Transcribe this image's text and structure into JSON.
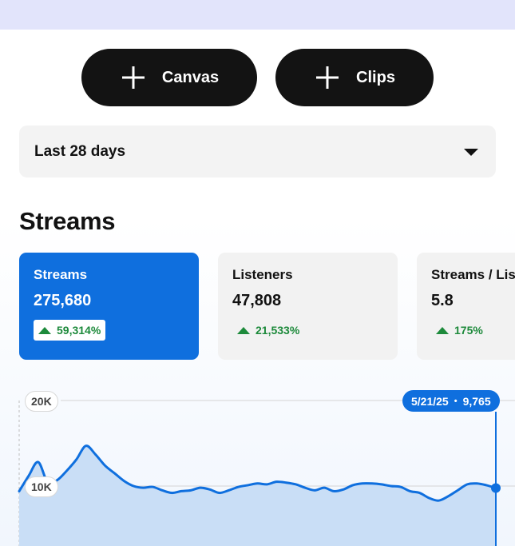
{
  "toolbar": {
    "canvas_label": "Canvas",
    "clips_label": "Clips",
    "plus_icon": "plus-icon"
  },
  "filter": {
    "selected": "Last 28 days",
    "caret_icon": "caret-down-icon"
  },
  "section": {
    "title": "Streams"
  },
  "cards": [
    {
      "label": "Streams",
      "value": "275,680",
      "change": "59,314%",
      "selected": true
    },
    {
      "label": "Listeners",
      "value": "47,808",
      "change": "21,533%",
      "selected": false
    },
    {
      "label": "Streams / Listener",
      "value": "5.8",
      "change": "175%",
      "selected": false
    }
  ],
  "colors": {
    "accent": "#0f6fde",
    "positive": "#1d8a3b",
    "button_bg": "#131313",
    "banner": "#e2e4fb"
  },
  "chart_data": {
    "type": "area",
    "y_ticks": [
      "20K",
      "10K"
    ],
    "ylim": [
      0,
      20000
    ],
    "grid": true,
    "series": [
      {
        "values": [
          9400,
          11200,
          12800,
          10400,
          10700,
          11800,
          13100,
          14700,
          13700,
          12400,
          11500,
          10600,
          10000,
          9800,
          9900,
          9500,
          9200,
          9400,
          9500,
          9800,
          9600,
          9200,
          9500,
          9900,
          10100,
          10300,
          10200,
          10500,
          10400,
          10200,
          9800,
          9500,
          9800,
          9400,
          9600,
          10100,
          10300,
          10300,
          10200,
          10000,
          9900,
          9400,
          9200,
          8600,
          8300,
          8800,
          9500,
          10200,
          10300,
          10100,
          9765
        ]
      }
    ],
    "tooltip": {
      "date": "5/21/25",
      "value": "9,765"
    }
  }
}
